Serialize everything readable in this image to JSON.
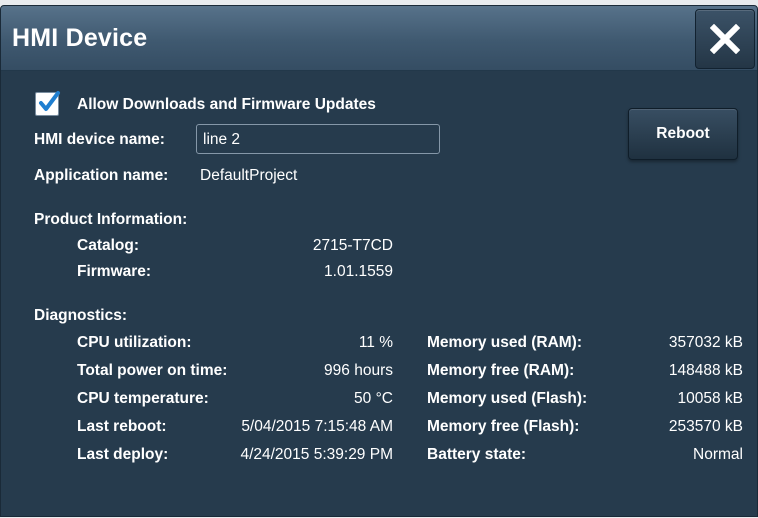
{
  "dialog": {
    "title": "HMI Device",
    "close_icon": "close-icon"
  },
  "settings": {
    "allow_downloads_label": "Allow Downloads and Firmware Updates",
    "allow_downloads_checked": true,
    "device_name_label": "HMI device name:",
    "device_name_value": "line 2",
    "application_name_label": "Application name:",
    "application_name_value": "DefaultProject",
    "reboot_label": "Reboot"
  },
  "product": {
    "heading": "Product Information:",
    "catalog_label": "Catalog:",
    "catalog_value": "2715-T7CD",
    "firmware_label": "Firmware:",
    "firmware_value": "1.01.1559"
  },
  "diagnostics": {
    "heading": "Diagnostics:",
    "left": [
      {
        "label": "CPU utilization:",
        "value": "11 %"
      },
      {
        "label": "Total power on time:",
        "value": "996 hours"
      },
      {
        "label": "CPU temperature:",
        "value": "50 °C"
      },
      {
        "label": "Last reboot:",
        "value": "5/04/2015 7:15:48 AM"
      },
      {
        "label": "Last deploy:",
        "value": "4/24/2015 5:39:29 PM"
      }
    ],
    "right": [
      {
        "label": "Memory used (RAM):",
        "value": "357032 kB"
      },
      {
        "label": "Memory free (RAM):",
        "value": "148488 kB"
      },
      {
        "label": "Memory used (Flash):",
        "value": "10058 kB"
      },
      {
        "label": "Memory free (Flash):",
        "value": "253570 kB"
      },
      {
        "label": "Battery state:",
        "value": "Normal"
      }
    ]
  }
}
